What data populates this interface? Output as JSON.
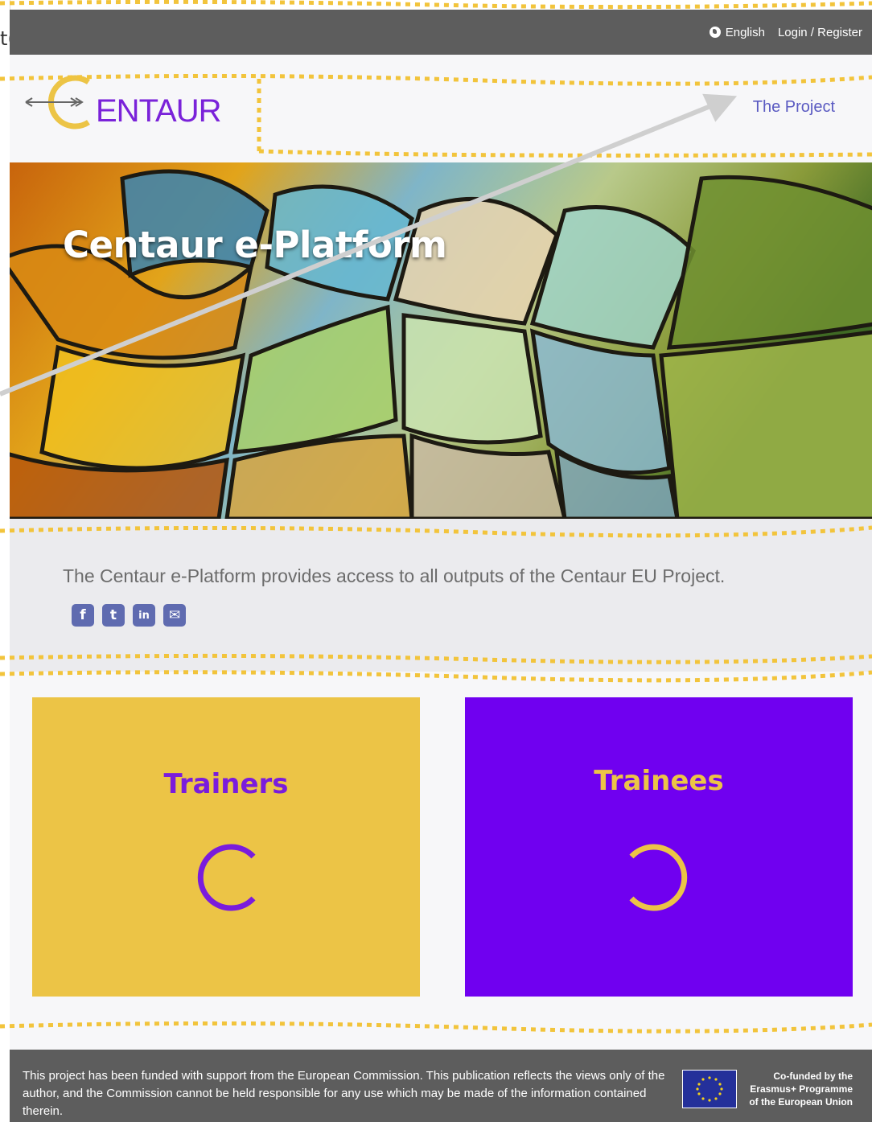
{
  "edge_fragment": "t(",
  "topbar": {
    "language": "English",
    "login": "Login / Register"
  },
  "header": {
    "logo_letter": "C",
    "logo_text": "ENTAUR",
    "nav_item": "The Project"
  },
  "hero": {
    "title": "Centaur e-Platform"
  },
  "intro": {
    "text": "The Centaur e-Platform provides access to all outputs of the Centaur EU Project."
  },
  "socials": [
    {
      "icon": "facebook-icon",
      "glyph": "f"
    },
    {
      "icon": "twitter-icon",
      "glyph": "t"
    },
    {
      "icon": "linkedin-icon",
      "glyph": "in"
    },
    {
      "icon": "email-icon",
      "glyph": "✉"
    }
  ],
  "cards": {
    "trainers": {
      "label": "Trainers",
      "bg": "#ecc446",
      "fg": "#7a1cdc"
    },
    "trainees": {
      "label": "Trainees",
      "bg": "#7000f0",
      "fg": "#ecc446"
    }
  },
  "footer": {
    "disclaimer": "This project has been funded with support from the European Commission. This publication reflects the views only of the author, and the Commission cannot be held responsible for any use which may be made of the information contained therein.",
    "eu_text": "Co-funded by the\nErasmus+ Programme\nof the European Union"
  },
  "colors": {
    "accent_yellow": "#ecc446",
    "accent_purple": "#7000f0",
    "annotation_dots": "#f2c43c",
    "annotation_arrow": "#cfcfcf"
  }
}
